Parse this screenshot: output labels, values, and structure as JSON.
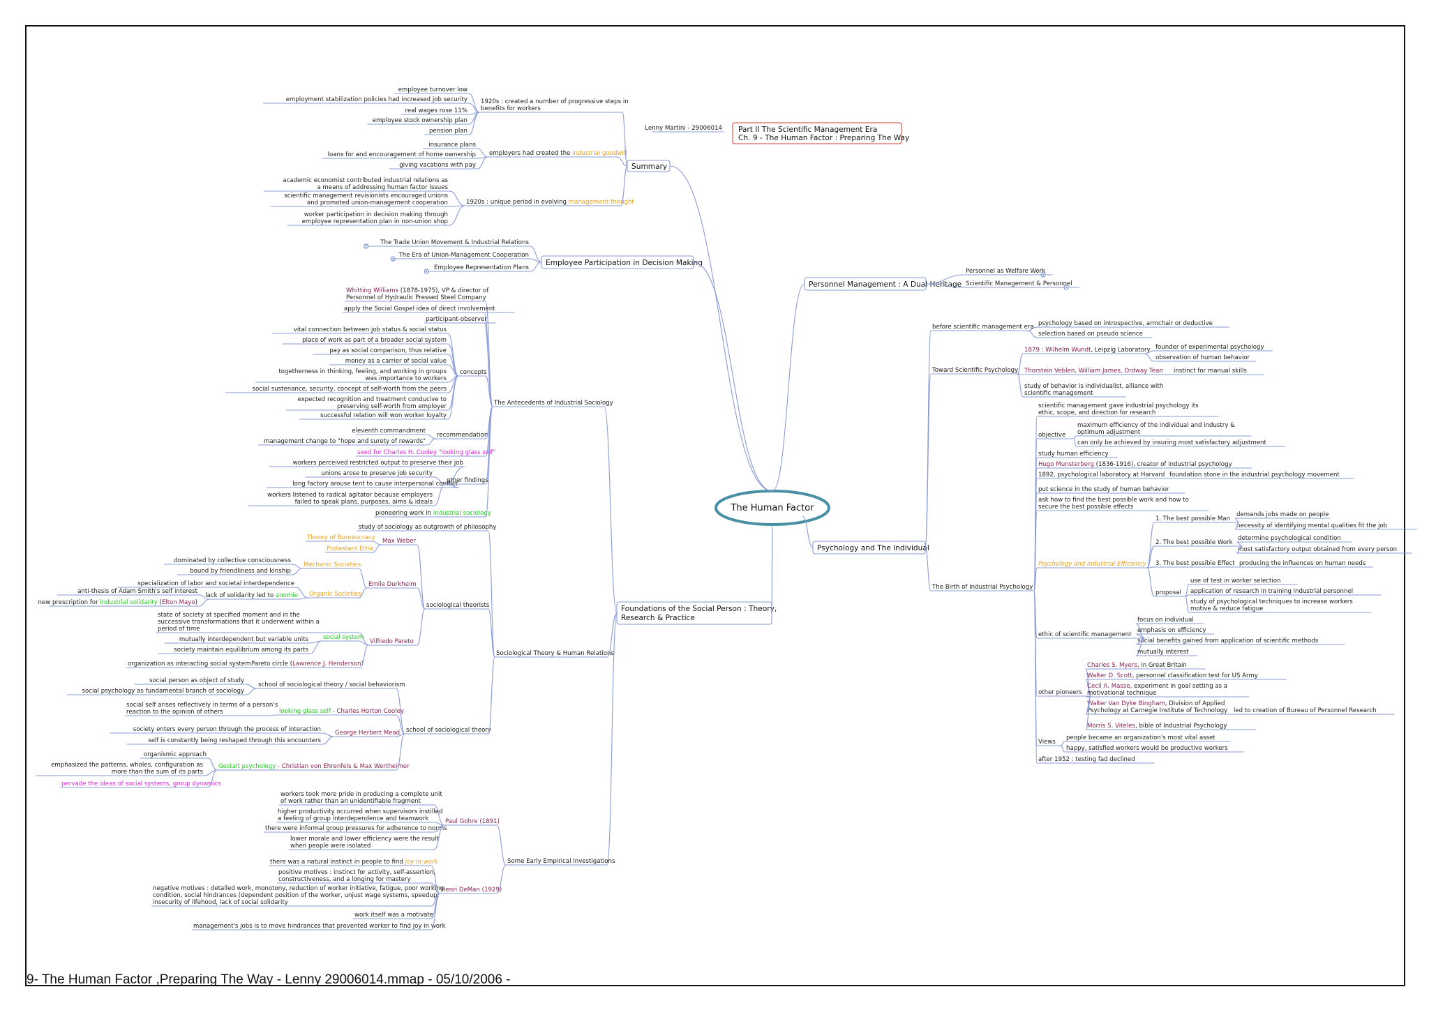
{
  "footer": "9- The Human Factor ,Preparing The Way - Lenny 29006014.mmap - 05/10/2006 -",
  "colors": {
    "connector": "#8a9bd6",
    "center_ellipse": "#4a90a4",
    "red_box": "#e0645a",
    "orange": "#e8a020",
    "green": "#22cc22",
    "magenta": "#dd22dd",
    "maroon": "#8b2050"
  },
  "mindmap": {
    "center": "The Human Factor",
    "author": "Lenny Martini - 29006014",
    "titlebox": [
      "Part II The Scientific Management Era",
      "Ch. 9 - The Human Factor : Preparing The Way"
    ],
    "summary": {
      "label": "Summary",
      "groups": [
        {
          "parts": [
            {
              "t": "1920s : created a number of progressive steps in"
            },
            {
              "t": "benefits for workers"
            }
          ],
          "items": [
            "employee turnover low",
            "employment stabilization policies had increased job security",
            "real wages rose 11%",
            "employee stock ownership plan",
            "pension plan"
          ]
        },
        {
          "parts": [
            {
              "t": "employers had created the "
            },
            {
              "t": "industrial goodwill",
              "c": "orange"
            }
          ],
          "items": [
            "insurance plans",
            "loans for and encouragement of home ownership",
            "giving vacations with pay"
          ]
        },
        {
          "parts": [
            {
              "t": "1920s : unique period in evolving "
            },
            {
              "t": "management thought",
              "c": "orange"
            }
          ],
          "items": [
            [
              "academic economist contributed industrial relations as",
              "a means of addressing human factor issues"
            ],
            [
              "scientific management revisionists encouraged unions",
              "and promoted union-management cooperation"
            ],
            [
              "worker participation in decision making through",
              "employee representation plan in non-union shop"
            ]
          ]
        }
      ]
    },
    "participation": {
      "label": "Employee Participation in Decision Making",
      "items": [
        "The Trade Union Movement & Industrial Relations",
        "The Era of Union-Management Cooperation",
        "Employee Representation Plans"
      ]
    },
    "foundations": {
      "label": [
        "Foundations of the Social Person : Theory,",
        "Research & Practice"
      ]
    },
    "antecedents": {
      "label": "The Antecedents of Industrial Sociology",
      "ww": [
        "Whitting Williams",
        " (1878-1975), VP & director of",
        "Personnel of Hydraulic Pressed Steel Company"
      ],
      "items": [
        "apply the Social Gospel idea of direct involvement",
        "participant-observer"
      ],
      "concepts": {
        "label": "concepts",
        "items": [
          "vital connection between job status & social status",
          "place of work as part of a broader social system",
          "pay as social comparison, thus relative",
          "money as a carrier of social value",
          [
            "togetherness in thinking, feeling, and working in groups",
            "was importance to workers"
          ],
          "social sustenance, security, concept of self-worth from the peers",
          [
            "expected recognition and treatment conducive to",
            "preserving self-worth from employer"
          ],
          "successful relation will won worker loyalty"
        ]
      },
      "recommendation": {
        "label": "recommendation",
        "items": [
          "eleventh commandment",
          "management change to \"hope and surety of rewards\""
        ]
      },
      "seed": "seed for Charles H. Cooley \"looking glass self\"",
      "other": {
        "label": "other findings",
        "items": [
          "workers perceived restricted output to preserve their job",
          "unions arose to preserve job security",
          "long factory arouse tent to cause interpersonal conflict",
          [
            "workers listened to radical agitator because employers",
            "failed to speak plans, purposes, aims & ideals"
          ]
        ]
      },
      "pioneering": [
        "pioneering work in ",
        "industrial sociology"
      ]
    },
    "sociological": {
      "label": "Sociological Theory & Human Relations",
      "outgrowth": "study of sociology as outgrowth of philosophy",
      "theorists": {
        "label": "sociological theorists",
        "weber": {
          "name": "Max Weber",
          "items": [
            "Theory of Bureaucracy",
            "Protestant Ethic"
          ]
        },
        "durkheim": {
          "name": "Emile Durkheim",
          "mech": {
            "label": "Mechanic Societies",
            "items": [
              "dominated by collective consciousness",
              "bound by friendliness and kinship"
            ]
          },
          "org": {
            "label": "Organic Societies",
            "items": [
              "specialization of labor and societal interdependence",
              "lack of solidarity led to ",
              "anomie",
              "anti-thesis of Adam Smith's self interest",
              "new prescription for ",
              "industrial solidarity",
              "Elton Mayo"
            ]
          }
        },
        "pareto": {
          "name": "Vilfredo Pareto",
          "state": [
            "state of society at specified moment and in the",
            "successive transformations that it underwent within a",
            "period of time"
          ],
          "system": "social system",
          "sys_items": [
            "mutually interdependent but variable units",
            "society maintain equilibrium among its parts"
          ],
          "circle_pre": "organization as interacting social system",
          "circle": "Pareto circle (",
          "henderson": "Lawrence J. Henderson"
        }
      },
      "school": {
        "label": "school of sociological theory",
        "first": "school of sociological theory / social behaviorism",
        "first_items": [
          "social person as object of study",
          "social psychology as fundamental branch of sociology"
        ],
        "cooley_pre": "looking glass self",
        "cooley": " - Charles Horton Cooley",
        "cooley_item": [
          "social self arises reflectively in terms of a person's",
          "reaction to the opinion of others"
        ],
        "mead": "George Herbert Mead",
        "mead_items": [
          "society enters every person through the process of interaction",
          "self is constantly being reshaped through this encounters"
        ],
        "gestalt": "Gestalt psychology",
        "gestalt_names": " - Christian von Ehrenfels & Max Wertheimer",
        "gestalt_items": [
          "organismic approach",
          [
            "emphasized the patterns, wholes, configuration as",
            "more than the sum of its parts"
          ]
        ],
        "pervade": "pervade the ideas of social systems, group dynamics"
      }
    },
    "empirical": {
      "label": "Some Early Empirical Investigations",
      "gohre": {
        "name": "Paul Gohre (1891)",
        "items": [
          [
            "workers took more pride in producing a complete unit",
            "of work rather than an unidentifiable fragment"
          ],
          [
            "higher productivity occurred when supervisors instilled",
            "a feeling of group interdependence and teamwork"
          ],
          "there were informal group pressures for adherence to norms",
          [
            "lower morale and lower efficiency were the result",
            "when people were isolated"
          ]
        ]
      },
      "deman": {
        "name": "Henri DeMan (1929)",
        "joy": [
          "there was a natural instinct in people to find ",
          "joy in work"
        ],
        "items": [
          [
            "positive motives : instinct for activity, self-assertion,",
            "constructiveness, and a longing for mastery"
          ],
          [
            "negative motives : detailed work, monotony, reduction of worker initiative, fatigue, poor working",
            "condition, social hindrances (dependent position of the worker, unjust wage systems, speedup,",
            "insecurity of lifehood, lack of social solidarity"
          ],
          "work itself was a motivate",
          "management's jobs is to move hindrances that prevented worker to find joy in work"
        ]
      }
    },
    "personnel": {
      "label": "Personnel Management :  A Dual Heritage",
      "items": [
        "Personnel as Welfare Work",
        "Scientific Management & Personnel"
      ]
    },
    "psych": {
      "label": "Psychology and The Individual",
      "before": {
        "label": "before scientific management era",
        "items": [
          "psychology based on introspective, armchair or deductive",
          "selection based on pseudo science"
        ]
      },
      "toward": {
        "label": "Toward Scientific Psychology",
        "wundt": [
          "1879 : Wilhelm Wundt",
          ", Leipzig Laboratory"
        ],
        "wundt_items": [
          "founder of experimental psychology",
          "observation of human behavior"
        ],
        "veblen": "Thorstein Veblen, William James, Ordway Tean",
        "instinct": "instinct for manual skills",
        "study": [
          "study of behavior is individualist, alliance with",
          "scientific management"
        ]
      },
      "birth": {
        "label": "The Birth of Industrial Psychology",
        "sm_gave": [
          "scientific management gave industrial psychology its",
          "ethic, scope, and direction for research"
        ],
        "objective": "objective",
        "obj_items": [
          [
            "maximum efficiency of the individual and industry &",
            "optimum adjustment"
          ],
          "can only be achieved by insuring most satisfactory adjustment"
        ],
        "study": "study human efficiency",
        "hugo": [
          "Hugo Munsterberg",
          " (1836-1916), creator of industrial psychology"
        ],
        "lab": "1892, psychological laboratory at Harvard",
        "stone": "foundation stone in the industrial psychology movement",
        "put": "put science in the study of human behavior",
        "ask": [
          "ask how to find the best possible work and how to",
          "secure the best  possible effects"
        ],
        "pie": "Psychology and Industrial Efficiency",
        "man": {
          "label": "1. The best possible Man",
          "items": [
            "demands jobs made on people",
            "necessity of identifying mental qualities fit the job"
          ]
        },
        "work": {
          "label": "2. The best possible Work",
          "items": [
            "determine psychological condition",
            "most satisfactory output obtained from every person"
          ]
        },
        "effect": {
          "label": "3. The best possible Effect",
          "item": "producing the influences on human needs"
        },
        "proposal": {
          "label": "proposal",
          "items": [
            "use of test in worker selection",
            "application of research in training industrial personnel",
            [
              "study of psychological techniques to increase workers",
              "motive & reduce fatigue"
            ]
          ]
        },
        "ethic": {
          "label": "ethic of scientific management",
          "items": [
            "focus on individual",
            "emphasis on efficiency",
            "social benefits gained from application of scientific methods",
            "mutually interest"
          ]
        },
        "pioneers": {
          "label": "other pioneers",
          "items": [
            [
              "Charles S. Myers",
              ", in Great Britain"
            ],
            [
              "Walter D. Scott",
              ", personnel classification test for US Army"
            ],
            [
              "Cecil A. Masse",
              ", experiment in goal setting as a",
              "motivational technique"
            ],
            [
              "Walter Van Dyke Bingham",
              ", Division of Applied",
              "Psychology at Carnegie Institute of Technology"
            ],
            [
              "Morris S. Viteles",
              ", bible of Industrial Psychology"
            ]
          ],
          "bureau": "led to creation of Bureau of Personnel Research"
        },
        "views": {
          "label": "Views",
          "items": [
            "people became an organization's most vital asset",
            "happy, satisfied workers would be productive workers"
          ]
        },
        "after": "after 1952 : testing fad declined"
      }
    }
  }
}
